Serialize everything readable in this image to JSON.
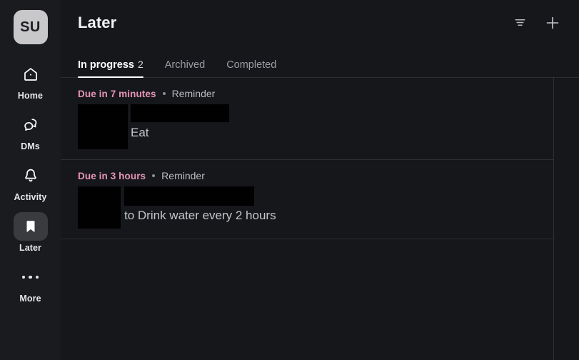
{
  "colors": {
    "sidebar_bg": "#191b1f",
    "main_bg": "#15171b",
    "border": "#2c2f34",
    "accent_pink": "#e894b7",
    "active_pill": "#3a3b3f",
    "avatar_bg": "#c8c8ca",
    "redaction": "#010101"
  },
  "sidebar": {
    "avatar": {
      "initials": "SU",
      "name": "user-avatar"
    },
    "items": [
      {
        "label": "Home",
        "icon": "home-icon",
        "active": false
      },
      {
        "label": "DMs",
        "icon": "dms-icon",
        "active": false
      },
      {
        "label": "Activity",
        "icon": "bell-icon",
        "active": false
      },
      {
        "label": "Later",
        "icon": "bookmark-icon",
        "active": true
      },
      {
        "label": "More",
        "icon": "ellipsis-icon",
        "active": false
      }
    ]
  },
  "header": {
    "title": "Later",
    "actions": [
      {
        "name": "filter-icon",
        "label": "Filter"
      },
      {
        "name": "plus-icon",
        "label": "New"
      }
    ]
  },
  "tabs": [
    {
      "label": "In progress",
      "count": "2",
      "active": true
    },
    {
      "label": "Archived",
      "count": "",
      "active": false
    },
    {
      "label": "Completed",
      "count": "",
      "active": false
    }
  ],
  "reminders": [
    {
      "due": "Due in 7 minutes",
      "separator": "•",
      "kind": "Reminder",
      "author_redacted": true,
      "avatar_redacted": true,
      "text": "Eat"
    },
    {
      "due": "Due in 3 hours",
      "separator": "•",
      "kind": "Reminder",
      "author_redacted": true,
      "avatar_redacted": true,
      "text": "to Drink water every 2 hours"
    }
  ]
}
